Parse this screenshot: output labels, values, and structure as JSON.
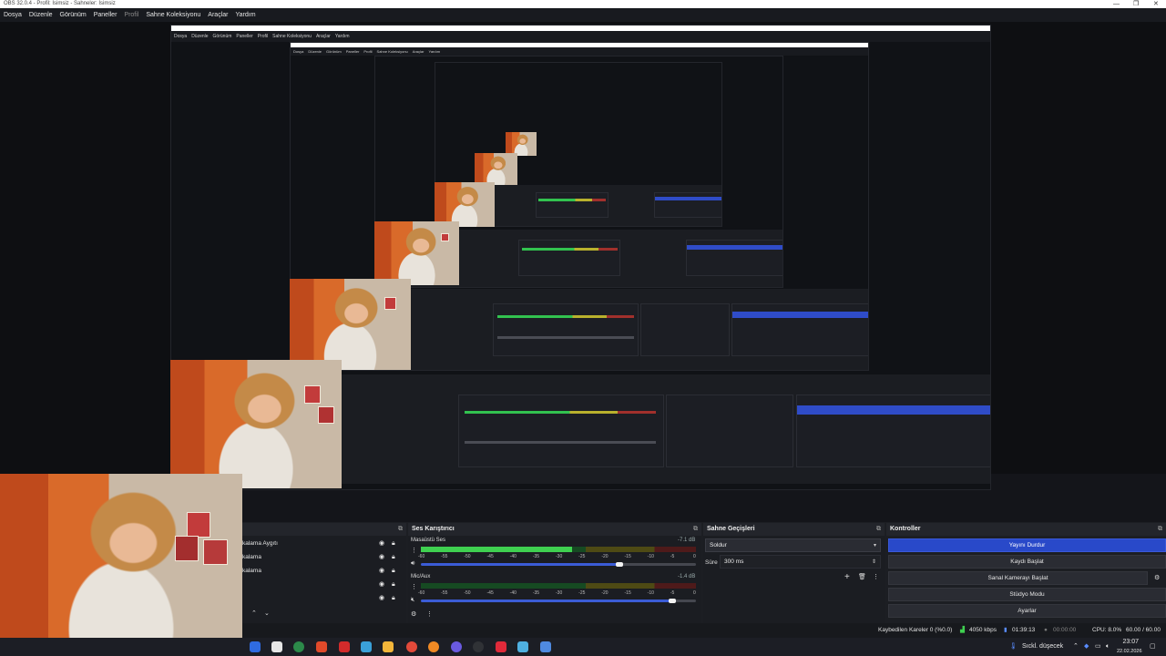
{
  "window": {
    "title": "OBS 32.0.4 - Profil: İsimsiz - Sahneler: İsimsiz",
    "controls": [
      "—",
      "❐",
      "✕"
    ]
  },
  "menu": {
    "items": [
      "Dosya",
      "Düzenle",
      "Görünüm",
      "Paneller",
      "Profil",
      "Sahne Koleksiyonu",
      "Araçlar",
      "Yardım"
    ]
  },
  "sources": {
    "rows": [
      "kalama Aygıtı",
      "kalama",
      "kalama"
    ]
  },
  "mixer": {
    "title": "Ses Karıştırıcı",
    "channels": [
      {
        "name": "Masaüstü Ses",
        "db": "-7.1 dB",
        "level": 0.55
      },
      {
        "name": "Mic/Aux",
        "db": "-1.4 dB",
        "level": 0.0
      }
    ],
    "scale": [
      "-60",
      "-55",
      "-50",
      "-45",
      "-40",
      "-35",
      "-30",
      "-25",
      "-20",
      "-15",
      "-10",
      "-5",
      "0"
    ]
  },
  "transitions": {
    "title": "Sahne Geçişleri",
    "selected": "Soldur",
    "duration_label": "Süre",
    "duration_value": "300 ms"
  },
  "controls": {
    "title": "Kontroller",
    "stop_stream": "Yayını Durdur",
    "start_record": "Kaydı Başlat",
    "start_virtualcam": "Sanal Kamerayı Başlat",
    "studio_mode": "Stüdyo Modu",
    "settings": "Ayarlar"
  },
  "status": {
    "dropped": "Kaybedilen Kareler 0 (%0.0)",
    "bitrate": "4050 kbps",
    "stream_time": "01:39:13",
    "record_time": "00:00:00",
    "cpu": "CPU: 8.0%",
    "fps": "60.00 / 60.00 FPS"
  },
  "taskbar": {
    "weather": "Sıckl. düşecek",
    "time": "23:07",
    "date": "22.02.2026"
  },
  "colors": {
    "accent": "#2949c9",
    "meter_green": "#3fd050",
    "meter_yellow": "#b9b12d",
    "meter_red": "#a1302c"
  }
}
